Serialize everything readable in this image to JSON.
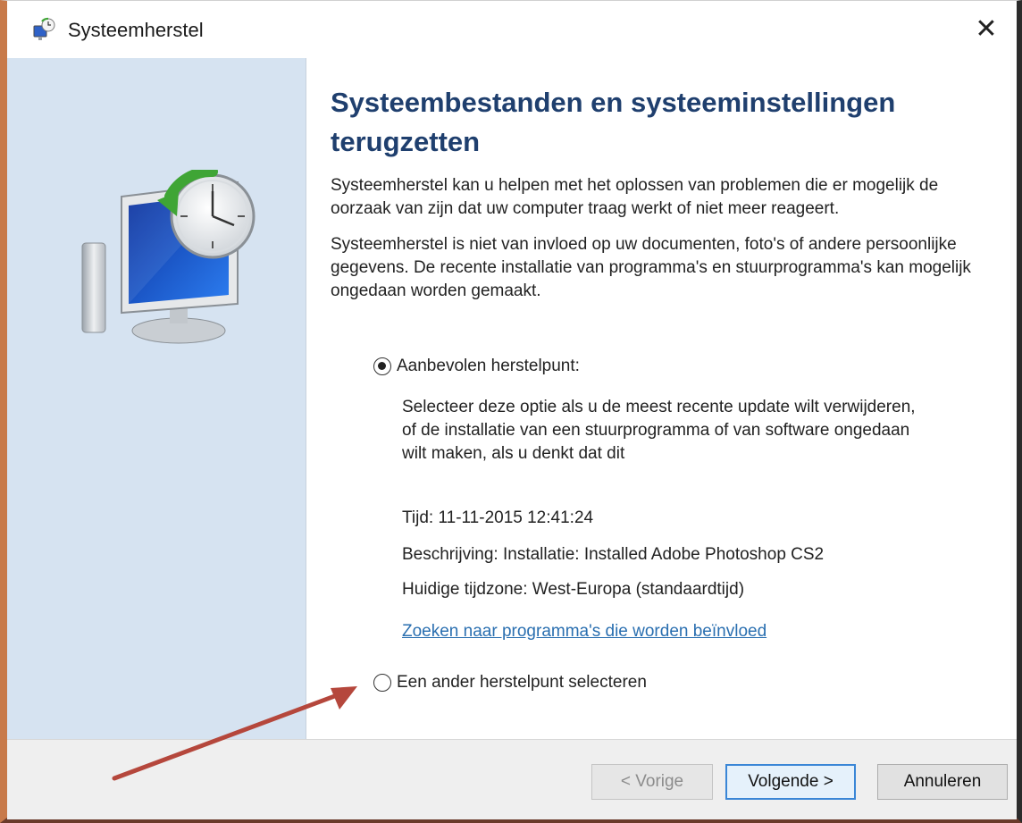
{
  "window": {
    "title": "Systeemherstel",
    "close_glyph": "✕",
    "app_icon": "system-restore-icon"
  },
  "main": {
    "heading": "Systeembestanden en systeeminstellingen terugzetten",
    "para1": "Systeemherstel kan u helpen met het oplossen van problemen die er mogelijk de oorzaak van zijn dat uw computer traag werkt of niet meer reageert.",
    "para2": "Systeemherstel is niet van invloed op uw documenten, foto's of andere persoonlijke gegevens. De recente installatie van programma's en stuurprogramma's kan mogelijk ongedaan worden gemaakt."
  },
  "options": {
    "recommended": {
      "label": "Aanbevolen herstelpunt:",
      "checked": true,
      "description": "Selecteer deze optie als u de meest recente update wilt verwijderen, of de installatie van een stuurprogramma of van software ongedaan wilt maken, als u denkt dat dit",
      "time": "Tijd: 11-11-2015 12:41:24",
      "description_line": "Beschrijving: Installatie: Installed Adobe Photoshop CS2",
      "timezone": "Huidige tijdzone: West-Europa (standaardtijd)",
      "link": "Zoeken naar programma's die worden beïnvloed"
    },
    "other": {
      "label": "Een ander herstelpunt selecteren",
      "checked": false
    }
  },
  "footer": {
    "back_label": "< Vorige",
    "next_label": "Volgende >",
    "cancel_label": "Annuleren"
  },
  "colors": {
    "side_panel": "#d6e3f1",
    "heading": "#1f3f6e",
    "link": "#2a6fb0",
    "annotation_arrow": "#b5473c"
  }
}
